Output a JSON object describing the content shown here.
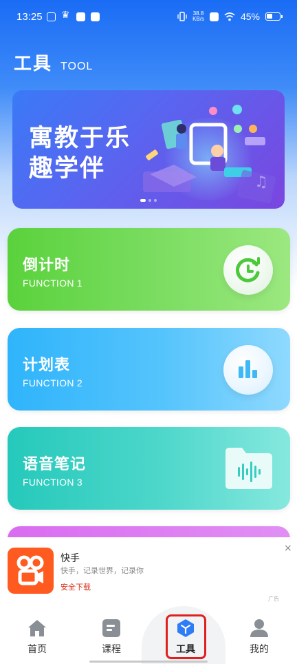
{
  "status_bar": {
    "time": "13:25",
    "netspeed_value": "38.8",
    "netspeed_unit": "KB/s",
    "battery": "45%"
  },
  "header": {
    "title": "工具",
    "subtitle": "TOOL"
  },
  "banner": {
    "text_line1": "寓教于乐",
    "text_line2": "趣学伴",
    "slide_index": 1,
    "slide_count": 3
  },
  "functions": [
    {
      "name": "倒计时",
      "sub": "FUNCTION 1",
      "icon": "countdown-icon"
    },
    {
      "name": "计划表",
      "sub": "FUNCTION 2",
      "icon": "chart-bars-icon"
    },
    {
      "name": "语音笔记",
      "sub": "FUNCTION 3",
      "icon": "voice-folder-icon"
    }
  ],
  "ad": {
    "app_name": "快手",
    "description": "快手，记录世界，记录你",
    "cta": "安全下载",
    "label": "广告",
    "close": "×"
  },
  "nav": {
    "home": "首页",
    "course": "课程",
    "tool": "工具",
    "mine": "我的"
  },
  "colors": {
    "accent_blue": "#1a6cf5",
    "card1": "#5ad23c",
    "card2": "#2fb4fb",
    "card3": "#25c9bb",
    "highlight": "#e02020"
  }
}
